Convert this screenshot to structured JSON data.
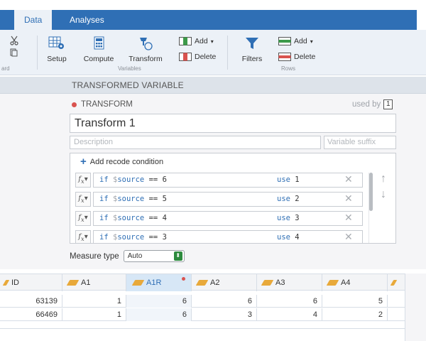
{
  "tabs": {
    "data": "Data",
    "analyses": "Analyses"
  },
  "ribbon": {
    "clip_label": "ard",
    "setup": "Setup",
    "compute": "Compute",
    "transform": "Transform",
    "variables_group": "Variables",
    "add_var": "Add",
    "delete_var": "Delete",
    "filters": "Filters",
    "add_row": "Add",
    "delete_row": "Delete",
    "rows_group": "Rows"
  },
  "panel": {
    "section_title": "TRANSFORMED VARIABLE",
    "transform_label": "TRANSFORM",
    "used_by_label": "used by",
    "used_by_count": "1",
    "name_value": "Transform 1",
    "description_placeholder": "Description",
    "suffix_placeholder": "Variable suffix",
    "add_recode": "Add recode condition",
    "conditions": [
      {
        "kw": "if",
        "dollar": "$",
        "src": "source",
        "op": "==",
        "val": "6",
        "use": "use",
        "result": "1"
      },
      {
        "kw": "if",
        "dollar": "$",
        "src": "source",
        "op": "==",
        "val": "5",
        "use": "use",
        "result": "2"
      },
      {
        "kw": "if",
        "dollar": "$",
        "src": "source",
        "op": "==",
        "val": "4",
        "use": "use",
        "result": "3"
      },
      {
        "kw": "if",
        "dollar": "$",
        "src": "source",
        "op": "==",
        "val": "3",
        "use": "use",
        "result": "4"
      }
    ],
    "measure_label": "Measure type",
    "measure_value": "Auto"
  },
  "grid": {
    "columns": [
      "ID",
      "A1",
      "A1R",
      "A2",
      "A3",
      "A4"
    ],
    "rows": [
      [
        "63139",
        "1",
        "6",
        "6",
        "6",
        "5"
      ],
      [
        "66469",
        "1",
        "6",
        "3",
        "4",
        "2"
      ]
    ]
  },
  "colors": {
    "accent": "#2f6fb5",
    "selected_col": "#d7e7f6",
    "status_dot": "#d9534f"
  }
}
